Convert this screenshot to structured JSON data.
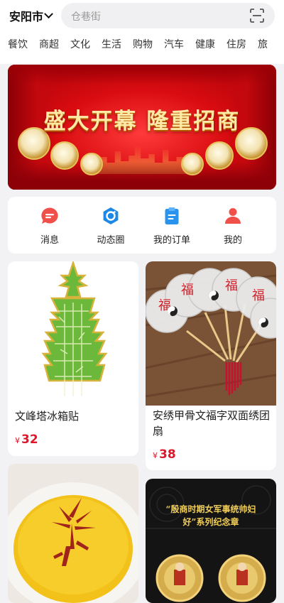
{
  "header": {
    "city": "安阳市",
    "search_placeholder": "仓巷街"
  },
  "categories": [
    "餐饮",
    "商超",
    "文化",
    "生活",
    "购物",
    "汽车",
    "健康",
    "住房",
    "旅"
  ],
  "banner": {
    "title": "盛大开幕 隆重招商"
  },
  "menu": [
    {
      "label": "消息",
      "icon": "message-icon",
      "color": "#f0504a"
    },
    {
      "label": "动态圈",
      "icon": "moments-icon",
      "color": "#1e88e5"
    },
    {
      "label": "我的订单",
      "icon": "order-icon",
      "color": "#2a93ee"
    },
    {
      "label": "我的",
      "icon": "user-icon",
      "color": "#f0504a"
    }
  ],
  "products": [
    {
      "name": "文峰塔冰箱贴",
      "currency": "¥",
      "price": "32"
    },
    {
      "name": "安绣甲骨文福字双面绣团扇",
      "currency": "¥",
      "price": "38"
    },
    {
      "name": "",
      "currency": "",
      "price": ""
    },
    {
      "name": "",
      "currency": "",
      "price": ""
    }
  ],
  "product4_image_text": "“殷商时期女军事统帅妇好”系列纪念章",
  "colors": {
    "accent": "#e0162b",
    "page_bg": "#f2f2f4"
  }
}
